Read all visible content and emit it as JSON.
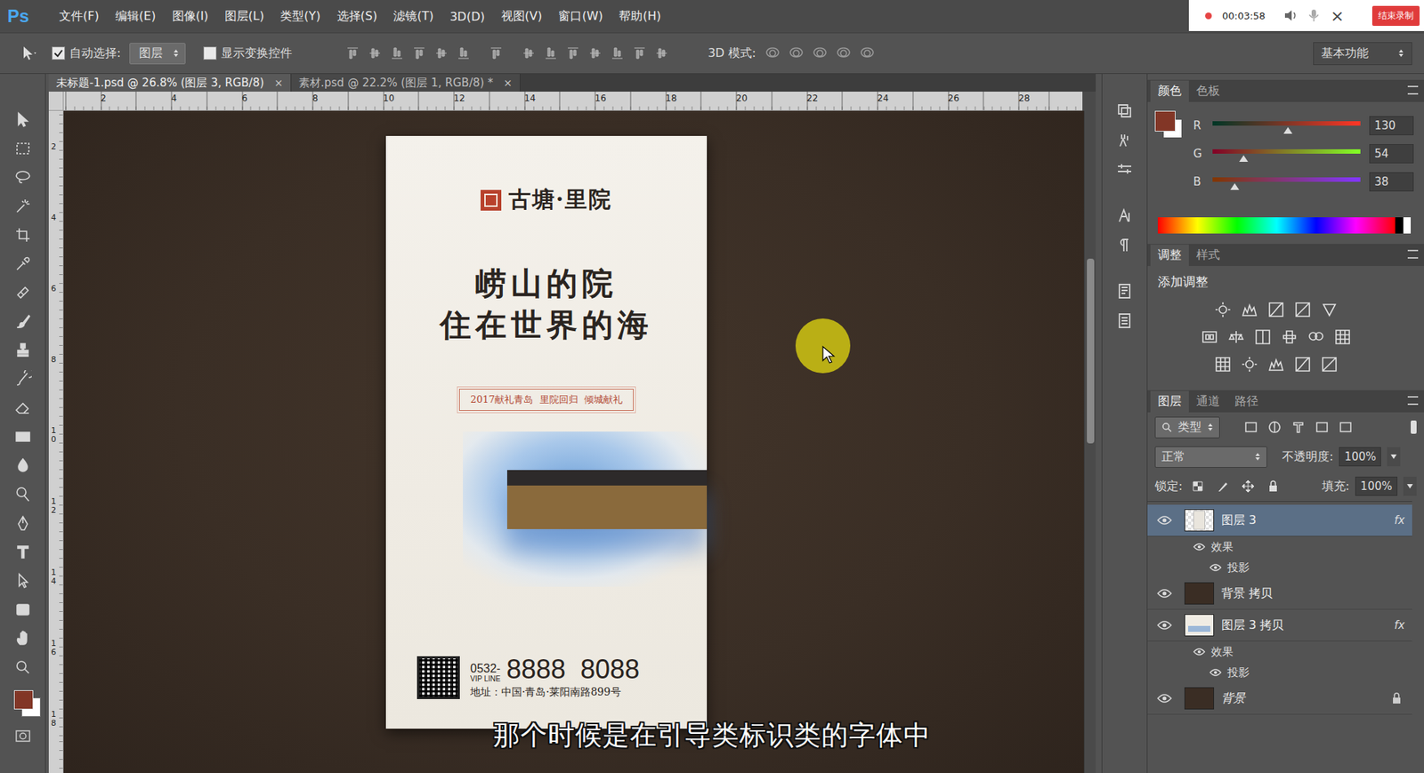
{
  "app": {
    "logo": "Ps"
  },
  "menu": [
    "文件(F)",
    "编辑(E)",
    "图像(I)",
    "图层(L)",
    "类型(Y)",
    "选择(S)",
    "滤镜(T)",
    "3D(D)",
    "视图(V)",
    "窗口(W)",
    "帮助(H)"
  ],
  "recorder": {
    "time": "00:03:58",
    "stop": "结束录制",
    "close": "×"
  },
  "options": {
    "auto_select": {
      "label": "自动选择:",
      "checked": true
    },
    "target": "图层",
    "show_transform": {
      "label": "显示变换控件",
      "checked": false
    },
    "mode_3d": "3D 模式:",
    "workspace": "基本功能"
  },
  "documents": [
    {
      "label": "未标题-1.psd @ 26.8% (图层 3, RGB/8)",
      "selected": true
    },
    {
      "label": "素材.psd @ 22.2% (图层 1, RGB/8) *",
      "selected": false
    }
  ],
  "doc_close": "×",
  "rulers": {
    "horizontal": [
      "2",
      "4",
      "6",
      "8",
      "10",
      "12",
      "14",
      "16",
      "18",
      "20",
      "22",
      "24",
      "26",
      "28"
    ],
    "vertical": [
      "2",
      "4",
      "6",
      "8",
      "10",
      "12",
      "14",
      "16",
      "18"
    ]
  },
  "poster": {
    "brand": "古塘·里院",
    "headline": [
      "崂山的院",
      "住在世界的海"
    ],
    "tag": "2017献礼青岛  里院回归  倾城献礼",
    "phone_prefix": "0532-",
    "phone_label": "VIP LINE",
    "phone": "8888  8088",
    "address": "地址：中国·青岛·莱阳南路899号"
  },
  "subtitle": "那个时候是在引导类标识类的字体中",
  "color_panel": {
    "tabs": [
      {
        "label": "颜色",
        "selected": true
      },
      {
        "label": "色板",
        "selected": false
      }
    ],
    "foreground": "#823626",
    "channels": [
      {
        "name": "R",
        "value": "130",
        "level": 0.51
      },
      {
        "name": "G",
        "value": "54",
        "level": 0.21
      },
      {
        "name": "B",
        "value": "38",
        "level": 0.15
      }
    ]
  },
  "adjust_panel": {
    "tabs": [
      {
        "label": "调整",
        "selected": true
      },
      {
        "label": "样式",
        "selected": false
      }
    ],
    "title": "添加调整"
  },
  "layers_panel": {
    "tabs": [
      {
        "label": "图层",
        "selected": true
      },
      {
        "label": "通道",
        "selected": false
      },
      {
        "label": "路径",
        "selected": false
      }
    ],
    "filter": "类型",
    "blend": "正常",
    "opacity_label": "不透明度:",
    "opacity": "100%",
    "lock_label": "锁定:",
    "fill_label": "填充:",
    "fill": "100%",
    "fx_label": "fx",
    "effects_label": "效果",
    "layers": [
      {
        "name": "图层 3",
        "selected": true,
        "visible": true,
        "locked": false,
        "fx": true,
        "thumb": "transparent",
        "effects": [
          "投影"
        ]
      },
      {
        "name": "背景 拷贝",
        "selected": false,
        "visible": true,
        "locked": false,
        "fx": false,
        "thumb": "dark",
        "effects": []
      },
      {
        "name": "图层 3 拷贝",
        "selected": false,
        "visible": true,
        "locked": false,
        "fx": true,
        "thumb": "poster",
        "effects": [
          "投影"
        ]
      },
      {
        "name": "背景",
        "selected": false,
        "visible": true,
        "locked": true,
        "fx": false,
        "thumb": "dark",
        "effects": []
      }
    ]
  }
}
